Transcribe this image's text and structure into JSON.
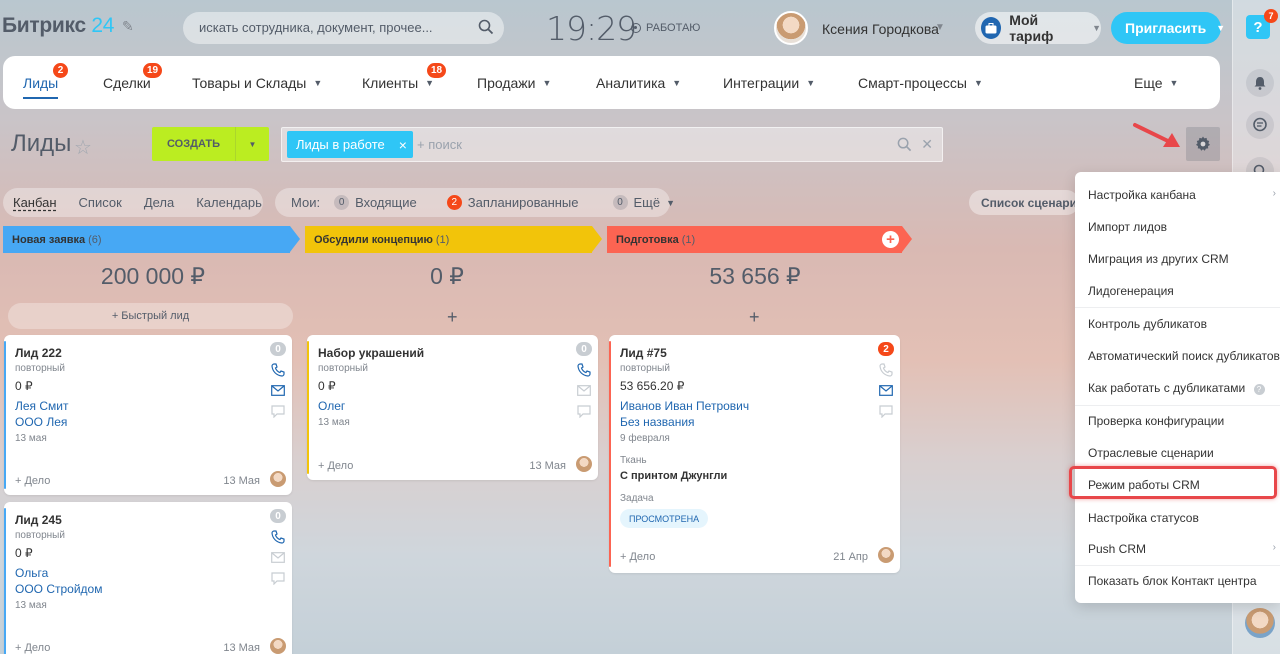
{
  "header": {
    "logo_main": "Битрикс",
    "logo_num": "24",
    "search_placeholder": "искать сотрудника, документ, прочее...",
    "clock": "19:29",
    "work_status": "РАБОТАЮ",
    "user_name": "Ксения Городкова",
    "tariff_label": "Мой тариф",
    "invite_label": "Пригласить",
    "help_label": "?",
    "help_badge": "7"
  },
  "nav": {
    "items": [
      {
        "label": "Лиды",
        "badge": "2"
      },
      {
        "label": "Сделки",
        "badge": "19"
      },
      {
        "label": "Товары и Склады"
      },
      {
        "label": "Клиенты",
        "badge": "18"
      },
      {
        "label": "Продажи"
      },
      {
        "label": "Аналитика"
      },
      {
        "label": "Интеграции"
      },
      {
        "label": "Смарт-процессы"
      },
      {
        "label": "Еще"
      }
    ]
  },
  "toolbar": {
    "page_title": "Лиды",
    "create_label": "СОЗДАТЬ",
    "filter_tag": "Лиды в работе",
    "filter_placeholder": "+ поиск"
  },
  "views": {
    "tabs": [
      "Канбан",
      "Список",
      "Дела",
      "Календарь"
    ],
    "my_label": "Мои:",
    "incoming_count": "0",
    "incoming_label": "Входящие",
    "planned_count": "2",
    "planned_label": "Запланированные",
    "more_count": "0",
    "more_label": "Ещё",
    "scenario_label": "Список сценариев"
  },
  "columns": [
    {
      "title": "Новая заявка",
      "count": "(6)",
      "sum": "200 000 ₽",
      "quick": "+ Быстрый лид",
      "color": "#47a8f4"
    },
    {
      "title": "Обсудили концепцию",
      "count": "(1)",
      "sum": "0 ₽",
      "color": "#f2c40a"
    },
    {
      "title": "Подготовка",
      "count": "(1)",
      "sum": "53 656 ₽",
      "color": "#fc6452"
    }
  ],
  "plus_symbol": "+",
  "cards": {
    "c1": {
      "title": "Лид 222",
      "sub": "повторный",
      "amount": "0 ₽",
      "contact": "Лея Смит",
      "company": "ООО Лея",
      "created": "13 мая",
      "task": "+ Дело",
      "date": "13 Мая",
      "badge": "0"
    },
    "c2": {
      "title": "Лид 245",
      "sub": "повторный",
      "amount": "0 ₽",
      "contact": "Ольга",
      "company": "ООО Стройдом",
      "created": "13 мая",
      "task": "+ Дело",
      "date": "13 Мая",
      "badge": "0"
    },
    "c3": {
      "title": "Набор украшений",
      "sub": "повторный",
      "amount": "0 ₽",
      "contact": "Олег",
      "created": "13 мая",
      "task": "+ Дело",
      "date": "13 Мая",
      "badge": "0"
    },
    "c4": {
      "title": "Лид #75",
      "sub": "повторный",
      "amount": "53 656.20 ₽",
      "contact": "Иванов Иван Петрович",
      "company": "Без названия",
      "created": "9 февраля",
      "field1_label": "Ткань",
      "field1_value": "С принтом Джунгли",
      "field2_label": "Задача",
      "field2_value": "ПРОСМОТРЕНА",
      "task": "+ Дело",
      "date": "21 Апр",
      "badge": "2"
    }
  },
  "dropdown": {
    "items": [
      "Настройка канбана",
      "Импорт лидов",
      "Миграция из других CRM",
      "Лидогенерация",
      "Контроль дубликатов",
      "Автоматический поиск дубликатов",
      "Как работать с дубликатами",
      "Проверка конфигурации",
      "Отраслевые сценарии",
      "Режим работы CRM",
      "Настройка статусов",
      "Push CRM",
      "Показать блок Контакт центра"
    ]
  },
  "colors": {
    "accent": "#2fc6f6",
    "link": "#2067b0",
    "create": "#bbed21",
    "badge": "#f54819",
    "highlight": "#e8474a"
  }
}
